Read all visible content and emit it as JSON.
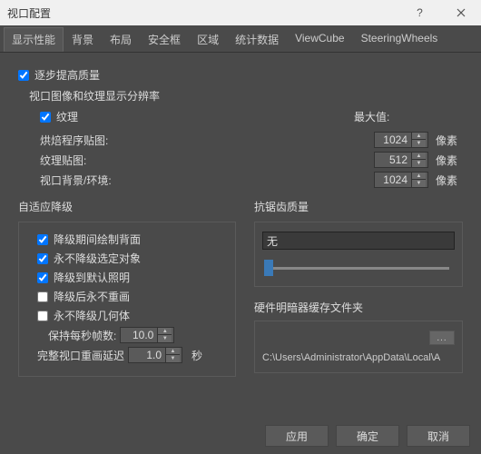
{
  "title": "视口配置",
  "tabs": [
    "显示性能",
    "背景",
    "布局",
    "安全框",
    "区域",
    "统计数据",
    "ViewCube",
    "SteeringWheels"
  ],
  "active_tab": 0,
  "progressive": {
    "label": "逐步提高质量",
    "checked": true
  },
  "resolution_label": "视口图像和纹理显示分辨率",
  "texture": {
    "label": "纹理",
    "checked": true
  },
  "max_label": "最大值:",
  "rows": [
    {
      "label": "烘焙程序贴图:",
      "value": "1024",
      "unit": "像素"
    },
    {
      "label": "纹理贴图:",
      "value": "512",
      "unit": "像素"
    },
    {
      "label": "视口背景/环境:",
      "value": "1024",
      "unit": "像素"
    }
  ],
  "adaptive": {
    "title": "自适应降级",
    "items": [
      {
        "label": "降级期间绘制背面",
        "checked": true
      },
      {
        "label": "永不降级选定对象",
        "checked": true
      },
      {
        "label": "降级到默认照明",
        "checked": true
      },
      {
        "label": "降级后永不重画",
        "checked": false
      },
      {
        "label": "永不降级几何体",
        "checked": false
      }
    ],
    "fps_label": "保持每秒帧数:",
    "fps_value": "10.0",
    "redraw_label": "完整视口重画延迟",
    "redraw_value": "1.0",
    "redraw_unit": "秒"
  },
  "aa": {
    "title": "抗锯齿质量",
    "value": "无"
  },
  "cache": {
    "title": "硬件明暗器缓存文件夹",
    "btn": "...",
    "path": "C:\\Users\\Administrator\\AppData\\Local\\A"
  },
  "buttons": {
    "apply": "应用",
    "ok": "确定",
    "cancel": "取消"
  }
}
